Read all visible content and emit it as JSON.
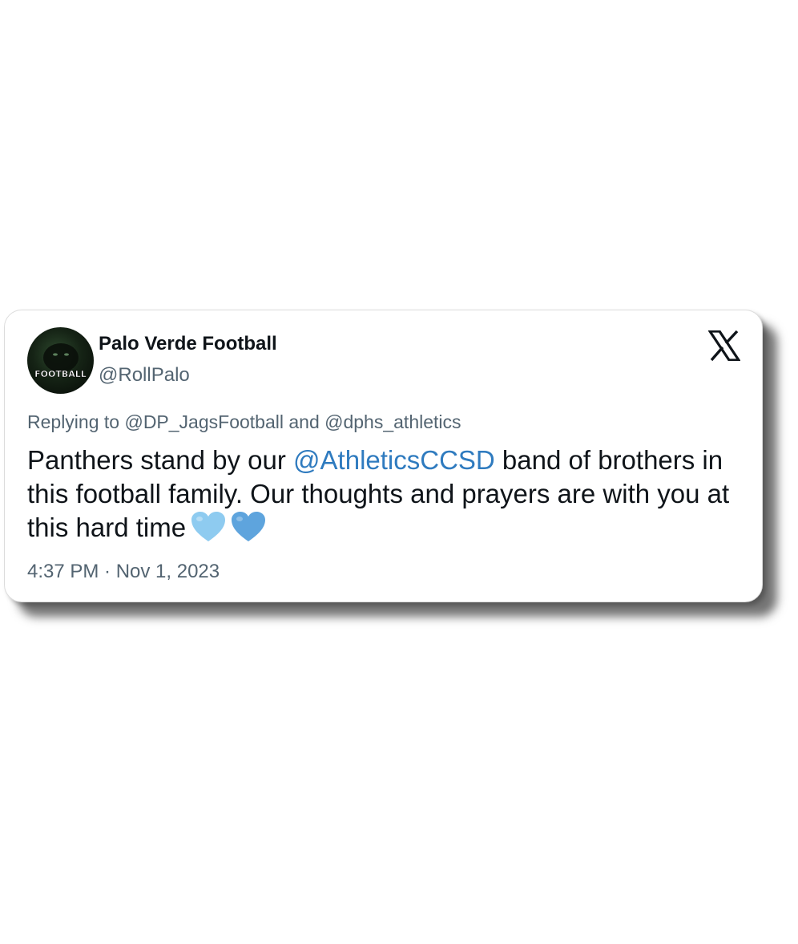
{
  "tweet": {
    "avatar_text": "FOOTBALL",
    "display_name": "Palo Verde Football",
    "handle": "@RollPalo",
    "platform_icon": "x-logo-icon",
    "reply": {
      "prefix": "Replying to ",
      "user1": "@DP_JagsFootball",
      "joiner": " and ",
      "user2": "@dphs_athletics"
    },
    "body": {
      "part1": "Panthers stand by our ",
      "mention": "@AthleticsCCSD",
      "part2": " band of brothers in this football family. Our thoughts and prayers are with you at this hard time",
      "emoji1": "light-blue-heart-icon",
      "emoji2": "blue-heart-icon"
    },
    "timestamp": "4:37 PM · Nov 1, 2023"
  },
  "colors": {
    "text": "#0f1419",
    "secondary": "#536471",
    "mention": "#2f7bbf",
    "heart_light": "#8ecbf0",
    "heart_blue": "#5ea4dd"
  }
}
